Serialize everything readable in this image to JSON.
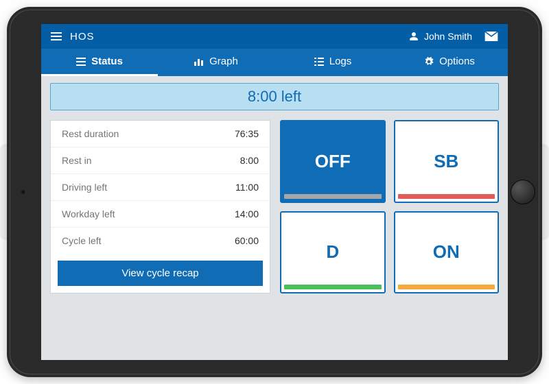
{
  "header": {
    "app_title": "HOS",
    "user_name": "John Smith"
  },
  "tabs": [
    {
      "label": "Status",
      "icon": "list-icon",
      "active": true
    },
    {
      "label": "Graph",
      "icon": "chart-icon",
      "active": false
    },
    {
      "label": "Logs",
      "icon": "logs-icon",
      "active": false
    },
    {
      "label": "Options",
      "icon": "gear-icon",
      "active": false
    }
  ],
  "timer": {
    "text": "8:00 left"
  },
  "stats": [
    {
      "label": "Rest duration",
      "value": "76:35"
    },
    {
      "label": "Rest in",
      "value": "8:00"
    },
    {
      "label": "Driving left",
      "value": "11:00"
    },
    {
      "label": "Workday left",
      "value": "14:00"
    },
    {
      "label": "Cycle left",
      "value": "60:00"
    }
  ],
  "buttons": {
    "view_recap": "View cycle recap"
  },
  "duty_status": {
    "selected": "OFF",
    "tiles": [
      {
        "code": "OFF",
        "bar_color": "#a3a7aa"
      },
      {
        "code": "SB",
        "bar_color": "#e15b5b"
      },
      {
        "code": "D",
        "bar_color": "#4bbf5d"
      },
      {
        "code": "ON",
        "bar_color": "#f3a93c"
      }
    ]
  },
  "colors": {
    "primary": "#106cb5",
    "topbar": "#045ea6",
    "timer_bg": "#b8def1"
  }
}
